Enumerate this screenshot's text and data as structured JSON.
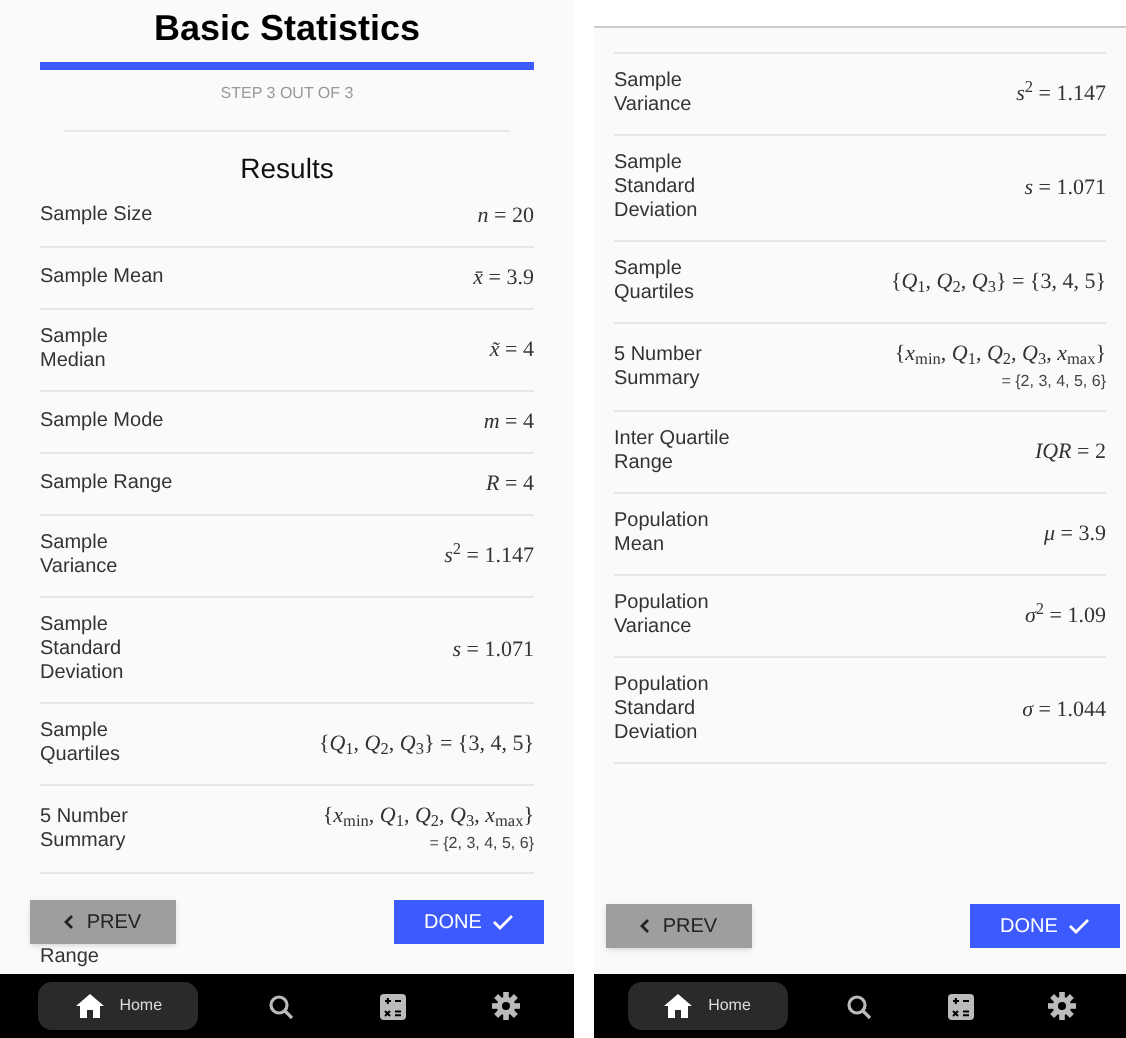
{
  "screens": [
    {
      "header": {
        "title": "Basic Statistics",
        "progress": {
          "level": 1
        },
        "step": "STEP 3 OUT OF 3",
        "section": "Results"
      },
      "rows": [
        {
          "label_lines": [
            "Sample Size"
          ],
          "value_lines": [
            "*n* = 20"
          ]
        },
        {
          "label_lines": [
            "Sample Mean"
          ],
          "value_lines": [
            "*x̄* = 3.9"
          ]
        },
        {
          "label_lines": [
            "Sample",
            "Median"
          ],
          "value_lines": [
            "*x̃* = 4"
          ]
        },
        {
          "label_lines": [
            "Sample Mode"
          ],
          "value_lines": [
            "*m* = 4"
          ]
        },
        {
          "label_lines": [
            "Sample Range"
          ],
          "value_lines": [
            "*R* = 4"
          ]
        },
        {
          "label_lines": [
            "Sample",
            "Variance"
          ],
          "value_lines": [
            "*s*$^{2}$ = 1.147"
          ]
        },
        {
          "label_lines": [
            "Sample",
            "Standard",
            "Deviation"
          ],
          "value_lines": [
            "*s* = 1.071"
          ]
        },
        {
          "label_lines": [
            "Sample",
            "Quartiles"
          ],
          "value_lines": [
            "{*Q*$_{1}$, *Q*$_{2}$, *Q*$_{3}$} = {3, 4, 5}"
          ]
        },
        {
          "label_lines": [
            "5 Number",
            "Summary"
          ],
          "value_lines": [
            "{*x*$_{min}$, *Q*$_{1}$, *Q*$_{2}$, *Q*$_{3}$, *x*$_{max}$}",
            "= {2, 3, 4, 5, 6}"
          ]
        },
        {
          "label_lines": [
            "Range"
          ],
          "value_lines": []
        }
      ],
      "prev": "PREV",
      "done": "DONE",
      "nav": [
        {
          "kind": "home",
          "label": "Home",
          "selected": true
        },
        {
          "kind": "search",
          "selected": false
        },
        {
          "kind": "calculator",
          "selected": false
        },
        {
          "kind": "settings",
          "selected": false
        }
      ]
    },
    {
      "rows": [
        {
          "label_lines": [
            "Sample",
            "Variance"
          ],
          "value_lines": [
            "*s*$^{2}$ = 1.147"
          ]
        },
        {
          "label_lines": [
            "Sample",
            "Standard",
            "Deviation"
          ],
          "value_lines": [
            "*s* = 1.071"
          ]
        },
        {
          "label_lines": [
            "Sample",
            "Quartiles"
          ],
          "value_lines": [
            "{*Q*$_{1}$, *Q*$_{2}$, *Q*$_{3}$} = {3, 4, 5}"
          ]
        },
        {
          "label_lines": [
            "5 Number",
            "Summary"
          ],
          "value_lines": [
            "{*x*$_{min}$, *Q*$_{1}$, *Q*$_{2}$, *Q*$_{3}$, *x*$_{max}$}",
            "= {2, 3, 4, 5, 6}"
          ]
        },
        {
          "label_lines": [
            "Inter Quartile",
            "Range"
          ],
          "value_lines": [
            "*IQR* = 2"
          ]
        },
        {
          "label_lines": [
            "Population",
            "Mean"
          ],
          "value_lines": [
            "*μ* = 3.9"
          ]
        },
        {
          "label_lines": [
            "Population",
            "Variance"
          ],
          "value_lines": [
            "*σ*$^{2}$ = 1.09"
          ]
        },
        {
          "label_lines": [
            "Population",
            "Standard",
            "Deviation"
          ],
          "value_lines": [
            "*σ* = 1.044"
          ]
        }
      ],
      "prev": "PREV",
      "done": "DONE",
      "nav": [
        {
          "kind": "home",
          "label": "Home",
          "selected": true
        },
        {
          "kind": "search",
          "selected": false
        },
        {
          "kind": "calculator",
          "selected": false
        },
        {
          "kind": "settings",
          "selected": false
        }
      ]
    }
  ]
}
